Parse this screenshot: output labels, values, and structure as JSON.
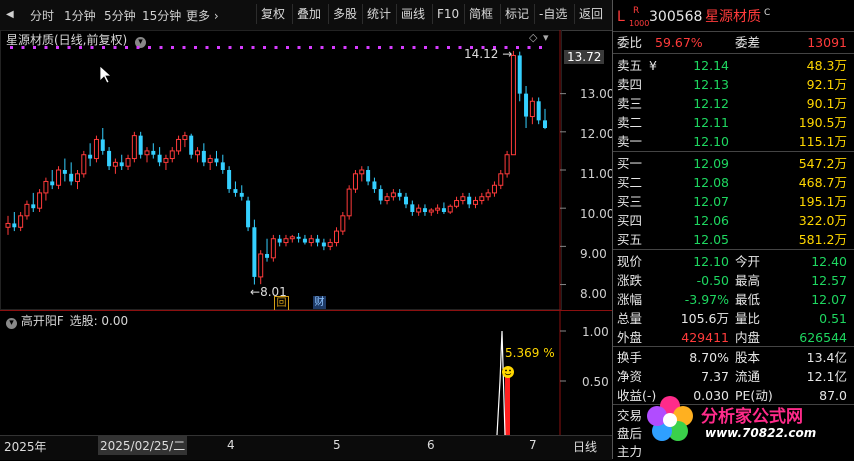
{
  "toolbar": {
    "back_label": "◀",
    "periods": [
      "分时",
      "1分钟",
      "5分钟",
      "15分钟",
      "更多 ›"
    ],
    "buttons": [
      "复权",
      "叠加",
      "多股",
      "统计",
      "画线",
      "F10",
      "简框",
      "标记",
      "-自选",
      "返回"
    ]
  },
  "main_chart": {
    "title": "星源材质(日线,前复权)",
    "high_label": "14.12",
    "low_label": "8.01",
    "marker_hui": "回",
    "marker_cai": "财",
    "highlight_price": "13.72",
    "y_ticks": [
      "13.00",
      "12.00",
      "11.00",
      "10.00",
      "9.00",
      "8.00"
    ]
  },
  "indicator": {
    "title": "高开阳F",
    "pick_label": "选股: 0.00",
    "value_label": "5.369",
    "pct_sign": "%",
    "y_ticks": [
      "1.00",
      "0.50"
    ]
  },
  "date_axis": {
    "labels": [
      "2025年",
      "2025/02/25/二",
      "4",
      "5",
      "6",
      "7"
    ],
    "period_label": "日线"
  },
  "chart_data": {
    "type": "candlestick",
    "title": "星源材质(日线,前复权)",
    "ylim": [
      7.7,
      14.3
    ],
    "annotations": {
      "high": 14.12,
      "low": 8.01
    },
    "candles": [
      {
        "o": 9.5,
        "h": 9.8,
        "l": 9.3,
        "c": 9.6
      },
      {
        "o": 9.6,
        "h": 9.9,
        "l": 9.4,
        "c": 9.5
      },
      {
        "o": 9.5,
        "h": 9.9,
        "l": 9.4,
        "c": 9.8
      },
      {
        "o": 9.8,
        "h": 10.2,
        "l": 9.7,
        "c": 10.1
      },
      {
        "o": 10.1,
        "h": 10.4,
        "l": 9.9,
        "c": 10.0
      },
      {
        "o": 10.0,
        "h": 10.5,
        "l": 9.9,
        "c": 10.4
      },
      {
        "o": 10.4,
        "h": 10.8,
        "l": 10.2,
        "c": 10.7
      },
      {
        "o": 10.7,
        "h": 11.0,
        "l": 10.5,
        "c": 10.6
      },
      {
        "o": 10.6,
        "h": 11.1,
        "l": 10.5,
        "c": 11.0
      },
      {
        "o": 11.0,
        "h": 11.3,
        "l": 10.7,
        "c": 10.9
      },
      {
        "o": 10.9,
        "h": 11.2,
        "l": 10.6,
        "c": 10.7
      },
      {
        "o": 10.7,
        "h": 11.0,
        "l": 10.5,
        "c": 10.9
      },
      {
        "o": 10.9,
        "h": 11.5,
        "l": 10.8,
        "c": 11.4
      },
      {
        "o": 11.4,
        "h": 11.7,
        "l": 11.1,
        "c": 11.3
      },
      {
        "o": 11.3,
        "h": 11.9,
        "l": 11.2,
        "c": 11.8
      },
      {
        "o": 11.8,
        "h": 12.1,
        "l": 11.4,
        "c": 11.5
      },
      {
        "o": 11.5,
        "h": 11.6,
        "l": 11.0,
        "c": 11.1
      },
      {
        "o": 11.1,
        "h": 11.3,
        "l": 10.9,
        "c": 11.2
      },
      {
        "o": 11.2,
        "h": 11.4,
        "l": 11.0,
        "c": 11.1
      },
      {
        "o": 11.1,
        "h": 11.4,
        "l": 11.0,
        "c": 11.3
      },
      {
        "o": 11.3,
        "h": 12.0,
        "l": 11.2,
        "c": 11.9
      },
      {
        "o": 11.9,
        "h": 12.0,
        "l": 11.3,
        "c": 11.4
      },
      {
        "o": 11.4,
        "h": 11.6,
        "l": 11.2,
        "c": 11.5
      },
      {
        "o": 11.5,
        "h": 11.7,
        "l": 11.3,
        "c": 11.4
      },
      {
        "o": 11.4,
        "h": 11.6,
        "l": 11.1,
        "c": 11.2
      },
      {
        "o": 11.2,
        "h": 11.4,
        "l": 11.0,
        "c": 11.3
      },
      {
        "o": 11.3,
        "h": 11.6,
        "l": 11.2,
        "c": 11.5
      },
      {
        "o": 11.5,
        "h": 11.9,
        "l": 11.4,
        "c": 11.8
      },
      {
        "o": 11.8,
        "h": 12.0,
        "l": 11.6,
        "c": 11.9
      },
      {
        "o": 11.9,
        "h": 11.95,
        "l": 11.3,
        "c": 11.4
      },
      {
        "o": 11.4,
        "h": 11.6,
        "l": 11.2,
        "c": 11.5
      },
      {
        "o": 11.5,
        "h": 11.7,
        "l": 11.1,
        "c": 11.2
      },
      {
        "o": 11.2,
        "h": 11.4,
        "l": 11.0,
        "c": 11.3
      },
      {
        "o": 11.3,
        "h": 11.5,
        "l": 11.1,
        "c": 11.2
      },
      {
        "o": 11.2,
        "h": 11.4,
        "l": 10.9,
        "c": 11.0
      },
      {
        "o": 11.0,
        "h": 11.1,
        "l": 10.4,
        "c": 10.5
      },
      {
        "o": 10.5,
        "h": 10.7,
        "l": 10.3,
        "c": 10.4
      },
      {
        "o": 10.4,
        "h": 10.6,
        "l": 10.2,
        "c": 10.3
      },
      {
        "o": 10.2,
        "h": 10.3,
        "l": 9.4,
        "c": 9.5
      },
      {
        "o": 9.5,
        "h": 9.7,
        "l": 8.0,
        "c": 8.2
      },
      {
        "o": 8.2,
        "h": 8.9,
        "l": 8.01,
        "c": 8.8
      },
      {
        "o": 8.8,
        "h": 9.2,
        "l": 8.6,
        "c": 8.7
      },
      {
        "o": 8.7,
        "h": 9.3,
        "l": 8.6,
        "c": 9.2
      },
      {
        "o": 9.2,
        "h": 9.3,
        "l": 9.0,
        "c": 9.1
      },
      {
        "o": 9.1,
        "h": 9.3,
        "l": 9.0,
        "c": 9.2
      },
      {
        "o": 9.2,
        "h": 9.3,
        "l": 9.1,
        "c": 9.25
      },
      {
        "o": 9.25,
        "h": 9.35,
        "l": 9.1,
        "c": 9.2
      },
      {
        "o": 9.2,
        "h": 9.3,
        "l": 9.05,
        "c": 9.1
      },
      {
        "o": 9.1,
        "h": 9.3,
        "l": 9.0,
        "c": 9.2
      },
      {
        "o": 9.2,
        "h": 9.3,
        "l": 9.0,
        "c": 9.1
      },
      {
        "o": 9.1,
        "h": 9.2,
        "l": 8.9,
        "c": 9.0
      },
      {
        "o": 9.0,
        "h": 9.2,
        "l": 8.9,
        "c": 9.1
      },
      {
        "o": 9.1,
        "h": 9.5,
        "l": 9.0,
        "c": 9.4
      },
      {
        "o": 9.4,
        "h": 9.9,
        "l": 9.3,
        "c": 9.8
      },
      {
        "o": 9.8,
        "h": 10.6,
        "l": 9.7,
        "c": 10.5
      },
      {
        "o": 10.5,
        "h": 11.0,
        "l": 10.4,
        "c": 10.9
      },
      {
        "o": 10.9,
        "h": 11.1,
        "l": 10.7,
        "c": 11.0
      },
      {
        "o": 11.0,
        "h": 11.1,
        "l": 10.6,
        "c": 10.7
      },
      {
        "o": 10.7,
        "h": 10.8,
        "l": 10.4,
        "c": 10.5
      },
      {
        "o": 10.5,
        "h": 10.6,
        "l": 10.1,
        "c": 10.2
      },
      {
        "o": 10.2,
        "h": 10.4,
        "l": 10.1,
        "c": 10.3
      },
      {
        "o": 10.3,
        "h": 10.5,
        "l": 10.2,
        "c": 10.4
      },
      {
        "o": 10.4,
        "h": 10.5,
        "l": 10.2,
        "c": 10.3
      },
      {
        "o": 10.3,
        "h": 10.4,
        "l": 10.0,
        "c": 10.1
      },
      {
        "o": 10.1,
        "h": 10.2,
        "l": 9.8,
        "c": 9.9
      },
      {
        "o": 9.9,
        "h": 10.1,
        "l": 9.8,
        "c": 10.0
      },
      {
        "o": 10.0,
        "h": 10.1,
        "l": 9.8,
        "c": 9.9
      },
      {
        "o": 9.9,
        "h": 10.0,
        "l": 9.8,
        "c": 9.95
      },
      {
        "o": 9.95,
        "h": 10.1,
        "l": 9.85,
        "c": 10.0
      },
      {
        "o": 10.0,
        "h": 10.15,
        "l": 9.85,
        "c": 9.9
      },
      {
        "o": 9.9,
        "h": 10.1,
        "l": 9.85,
        "c": 10.05
      },
      {
        "o": 10.05,
        "h": 10.3,
        "l": 10.0,
        "c": 10.2
      },
      {
        "o": 10.2,
        "h": 10.4,
        "l": 10.1,
        "c": 10.3
      },
      {
        "o": 10.3,
        "h": 10.4,
        "l": 10.0,
        "c": 10.1
      },
      {
        "o": 10.1,
        "h": 10.3,
        "l": 10.0,
        "c": 10.2
      },
      {
        "o": 10.2,
        "h": 10.4,
        "l": 10.1,
        "c": 10.3
      },
      {
        "o": 10.3,
        "h": 10.5,
        "l": 10.2,
        "c": 10.4
      },
      {
        "o": 10.4,
        "h": 10.7,
        "l": 10.3,
        "c": 10.6
      },
      {
        "o": 10.6,
        "h": 11.0,
        "l": 10.5,
        "c": 10.9
      },
      {
        "o": 10.9,
        "h": 11.5,
        "l": 10.8,
        "c": 11.4
      },
      {
        "o": 11.4,
        "h": 14.12,
        "l": 11.4,
        "c": 14.0
      },
      {
        "o": 14.0,
        "h": 14.1,
        "l": 12.8,
        "c": 13.0
      },
      {
        "o": 13.0,
        "h": 13.2,
        "l": 12.1,
        "c": 12.4
      },
      {
        "o": 12.4,
        "h": 12.9,
        "l": 12.2,
        "c": 12.8
      },
      {
        "o": 12.8,
        "h": 12.9,
        "l": 12.2,
        "c": 12.3
      },
      {
        "o": 12.3,
        "h": 12.6,
        "l": 12.07,
        "c": 12.1
      }
    ]
  },
  "quote": {
    "flag_L": "L",
    "flag_R": "R",
    "flag_num": "1000",
    "code": "300568",
    "name": "星源材质",
    "name_sup": "C",
    "weibi_label": "委比",
    "weibi": "59.67%",
    "weicha_label": "委差",
    "weicha": "13091",
    "asks": [
      {
        "label": "卖五",
        "mark": "¥",
        "price": "12.14",
        "vol": "48.3万"
      },
      {
        "label": "卖四",
        "mark": "",
        "price": "12.13",
        "vol": "92.1万"
      },
      {
        "label": "卖三",
        "mark": "",
        "price": "12.12",
        "vol": "90.1万"
      },
      {
        "label": "卖二",
        "mark": "",
        "price": "12.11",
        "vol": "190.5万"
      },
      {
        "label": "卖一",
        "mark": "",
        "price": "12.10",
        "vol": "115.1万"
      }
    ],
    "bids": [
      {
        "label": "买一",
        "price": "12.09",
        "vol": "547.2万"
      },
      {
        "label": "买二",
        "price": "12.08",
        "vol": "468.7万"
      },
      {
        "label": "买三",
        "price": "12.07",
        "vol": "195.1万"
      },
      {
        "label": "买四",
        "price": "12.06",
        "vol": "322.0万"
      },
      {
        "label": "买五",
        "price": "12.05",
        "vol": "581.2万"
      }
    ],
    "stats": [
      {
        "l1": "现价",
        "v1": "12.10",
        "c1": "green",
        "l2": "今开",
        "v2": "12.40",
        "c2": "green"
      },
      {
        "l1": "涨跌",
        "v1": "-0.50",
        "c1": "green",
        "l2": "最高",
        "v2": "12.57",
        "c2": "green"
      },
      {
        "l1": "涨幅",
        "v1": "-3.97%",
        "c1": "green",
        "l2": "最低",
        "v2": "12.07",
        "c2": "green"
      },
      {
        "l1": "总量",
        "v1": "105.6万",
        "c1": "white",
        "l2": "量比",
        "v2": "0.51",
        "c2": "green"
      },
      {
        "l1": "外盘",
        "v1": "429411",
        "c1": "red",
        "l2": "内盘",
        "v2": "626544",
        "c2": "green"
      }
    ],
    "stats2": [
      {
        "l1": "换手",
        "v1": "8.70%",
        "l2": "股本",
        "v2": "13.4亿"
      },
      {
        "l1": "净资",
        "v1": "7.37",
        "l2": "流通",
        "v2": "12.1亿"
      },
      {
        "l1": "收益(-)",
        "v1": "0.030",
        "l2": "PE(动)",
        "v2": "87.0"
      }
    ],
    "partial1": "交易",
    "partial2": "盘后",
    "partial3": "主力"
  },
  "watermark": {
    "title": "分析家公式网",
    "url": "www.70822.com"
  }
}
